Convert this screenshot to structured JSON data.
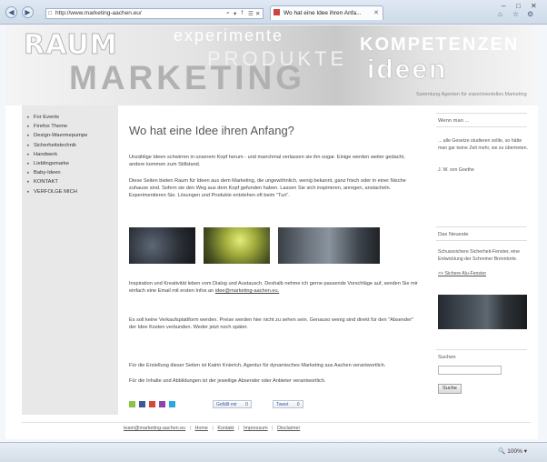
{
  "browser": {
    "url": "http://www.marketing-aachen.eu/",
    "tab_title": "Wo hat eine Idee ihren Anfa...",
    "back_icon": "back-arrow-icon",
    "forward_icon": "forward-arrow-icon",
    "address_actions": [
      "⌕",
      "▾",
      "⭡",
      "☰",
      "✕"
    ],
    "window_buttons": [
      "–",
      "□",
      "✕"
    ],
    "toolbar_icons": [
      "⌂",
      "☆",
      "⚙"
    ],
    "zoom": "100%"
  },
  "banner": {
    "word_raum": "RAUM",
    "word_marketing": "MARKETING",
    "word_experimente": "experimente",
    "word_produkte": "PRODUKTE",
    "word_kompetenzen": "KOMPETENZEN",
    "word_ideen": "ideen",
    "tagline": "Sammlung Agenten für experimentelles Marketing"
  },
  "left_nav": {
    "items": [
      "For Events",
      "Firefox Theme",
      "Design-Waermepumpe",
      "Sicherheitstechnik",
      "Handwerk",
      "Lieblingsmarke",
      "Baby-Ideen",
      "KONTAKT",
      "VERFOLGE MICH"
    ]
  },
  "main": {
    "title": "Wo hat eine Idee ihren Anfang?",
    "p1": "Unzählige Ideen schwirren in unserem Kopf herum - und manchmal verlassen sie ihn sogar. Einige werden weiter gedacht, andere kommen zum Stillstand.",
    "p2": "Diese Seiten bieten Raum für Ideen aus dem Marketing, die ungewöhnlich, wenig bekannt, ganz frisch oder in einer Nische zuhause sind. Sofern sie den Weg aus dem Kopf gefunden haben. Lassen Sie sich inspirieren, anregen, anstacheln. Experimentieren Sie. Lösungen und Produkte entstehen oft beim \"Tun\".",
    "p3_text": "Inspiration und Kreativität leben vom Dialog und Austausch. Deshalb nehme ich gerne passende Vorschläge auf, senden Sie mir einfach eine Email mit ersten Infos an",
    "p3_email": "idee@marketing-aachen.eu.",
    "p4": "Es soll keine Verkaufsplattform werden. Preise werden hier nicht zu sehen sein. Genauso wenig sind direkt für den \"Absender\" der Idee Kosten verbunden. Weder jetzt noch später.",
    "p5": "Für die Erstellung dieser Seiten ist Katrin Knierich, Agentur für dynamisches Marketing aus Aachen verantwortlich.",
    "p6": "Für die Inhalte und Abbildungen ist der jeweilige Absender oder Anbieter verantwortlich.",
    "share_label": "Gefällt mir",
    "share_count": "0",
    "tweet_label": "Tweet",
    "tweet_count": "0"
  },
  "sidebar": {
    "quote_heading": "Wenn man ...",
    "quote_text": "... alle Gesetze studieren sollte, so hätte man gar keine Zeit mehr, sie zu übertreten.",
    "quote_author": "J. W. von Goethe",
    "news_heading": "Das Neueste",
    "news_text": "Schusssichere Sicherheit-Fenster, eine Entwicklung der Schreiner Brenntorte.",
    "news_link": ">> Sichere Alu-Fenster",
    "search_heading": "Suchen",
    "search_button": "Suche"
  },
  "footer": {
    "email": "team@marketing-aachen.eu",
    "links": [
      "Home",
      "Kontakt",
      "Impressum",
      "Disclaimer"
    ]
  },
  "colors": {
    "social": [
      "#8bc34a",
      "#3b5998",
      "#d34836",
      "#8e44ad",
      "#29a9df"
    ]
  }
}
